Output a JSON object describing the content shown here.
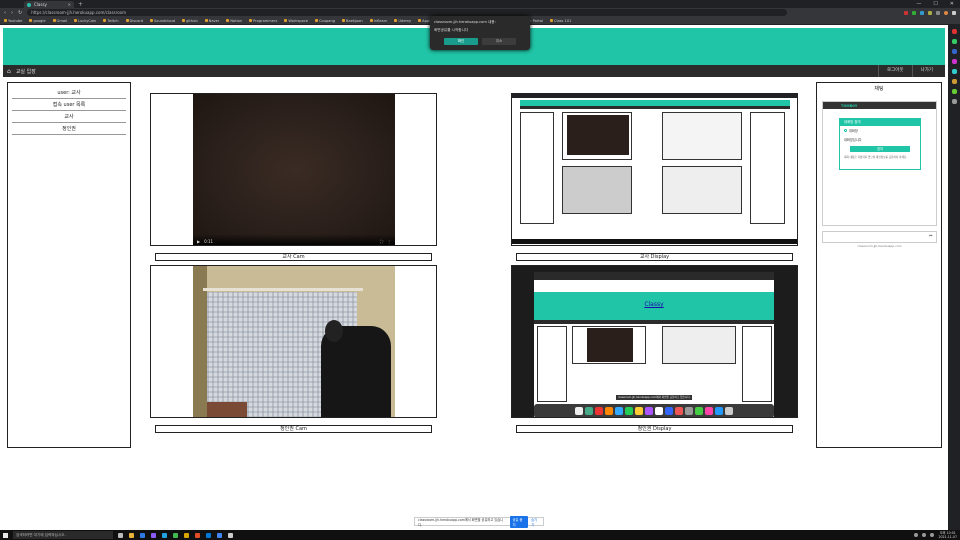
{
  "browser": {
    "tab_title": "Classy",
    "url": "https://classroom-jjh.herokuapp.com/classroom",
    "bookmarks": [
      "Youtube",
      "google",
      "Gmail",
      "LuckyCoin",
      "Twitch",
      "Discord",
      "Soundcloud",
      "github",
      "Naver",
      "Notion",
      "Programmers",
      "Workspace",
      "Coupang",
      "Baekjoon",
      "Inflearn",
      "Udemy",
      "Apple",
      "Windows",
      "Velog",
      "Medium",
      "Member Portal",
      "Class 101"
    ]
  },
  "popup": {
    "line1": "classroom-jjh.herokuapp.com 내용:",
    "line2": "화면공유를 시작합니다",
    "ok_label": "확인",
    "cancel_label": "취소"
  },
  "topnav": {
    "title": "교실 입장",
    "logout_label": "로그아웃",
    "leave_label": "나가기"
  },
  "userlist": {
    "items": [
      "user: 교사",
      "접속 user 목록",
      "교사",
      "정인권"
    ]
  },
  "tiles": [
    {
      "caption": "교사 Cam"
    },
    {
      "caption": "교사 Display"
    },
    {
      "caption": "정인권 Cam"
    },
    {
      "caption": "정인권 Display"
    }
  ],
  "cam_controls": {
    "play": "▶",
    "time": "0:11"
  },
  "share_screen": {
    "site_title": "Classy"
  },
  "chat": {
    "title": "채팅",
    "brand": "TOMBOY",
    "card_head": "대화방 참여",
    "option1": "대화방",
    "option2": "대화방입니다",
    "join_label": "참여",
    "note": "대화 내용은 저장되지 않으며 개인정보를 공유하지 마세요.",
    "send_icon": "send-icon",
    "footer": "classroom-jjh.herokuapp.com"
  },
  "sharebar": {
    "text": "classroom-jjh.herokuapp.com에서 화면을 공유하고 있습니다.",
    "stop_label": "공유 중지",
    "hide_label": "숨기기"
  },
  "taskbar": {
    "search_placeholder": "검색하려면 여기에 입력하십시오.",
    "time": "오후 10:01",
    "date": "2021-11-07"
  },
  "colors": {
    "accent": "#20c4a6",
    "nav": "#2b2b2b"
  }
}
